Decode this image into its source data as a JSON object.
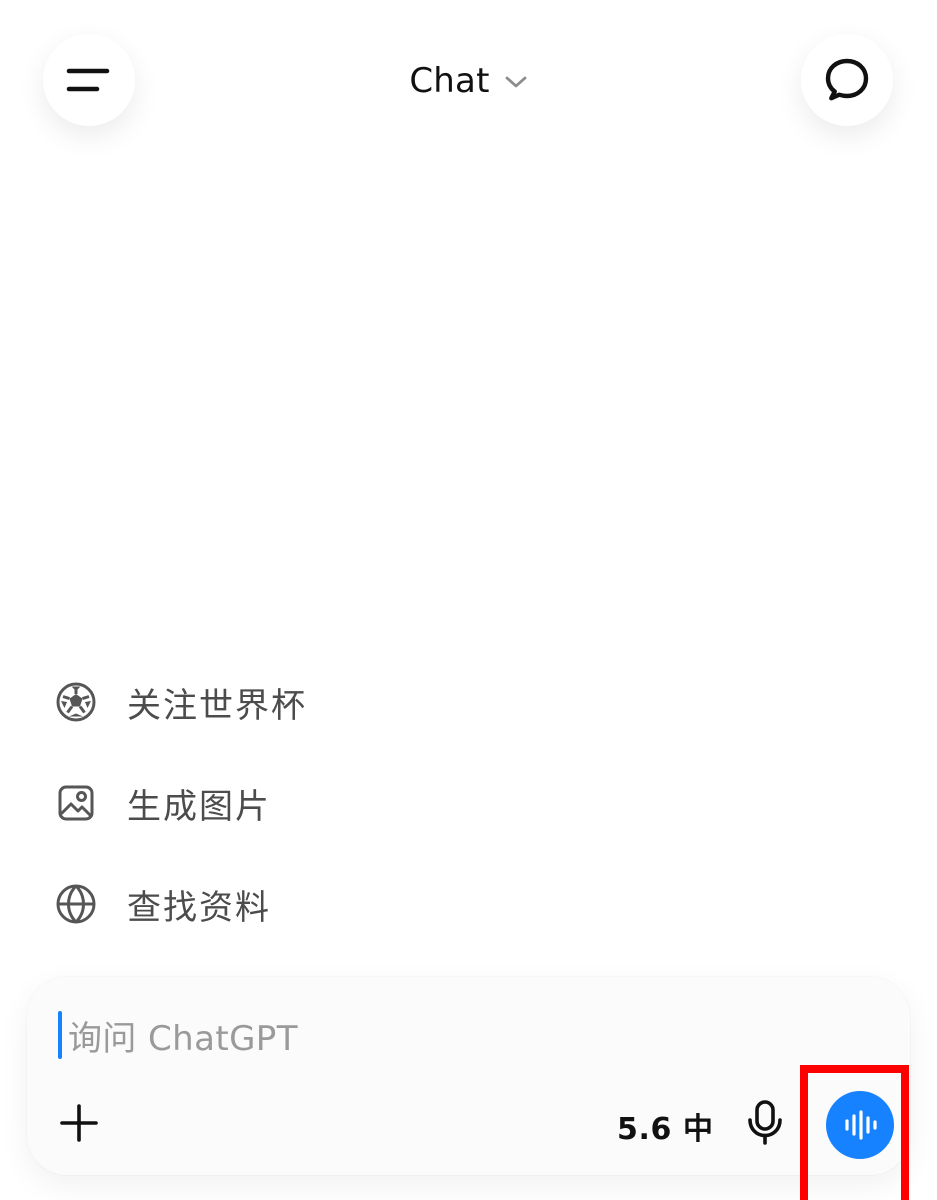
{
  "header": {
    "title": "Chat",
    "menu_icon": "menu-icon",
    "title_chevron_icon": "chevron-down-icon",
    "new_chat_icon": "new-chat-bubble-icon"
  },
  "suggestions": {
    "items": [
      {
        "label": "关注世界杯",
        "icon": "soccer-ball-icon"
      },
      {
        "label": "生成图片",
        "icon": "image-icon"
      },
      {
        "label": "查找资料",
        "icon": "globe-icon"
      }
    ]
  },
  "composer": {
    "placeholder": "询问 ChatGPT",
    "model_label": "5.6 中",
    "plus_icon": "plus-icon",
    "mic_icon": "microphone-icon",
    "voice_icon": "voice-waveform-icon"
  },
  "colors": {
    "accent": "#1682ff",
    "highlight": "#ff0000"
  }
}
